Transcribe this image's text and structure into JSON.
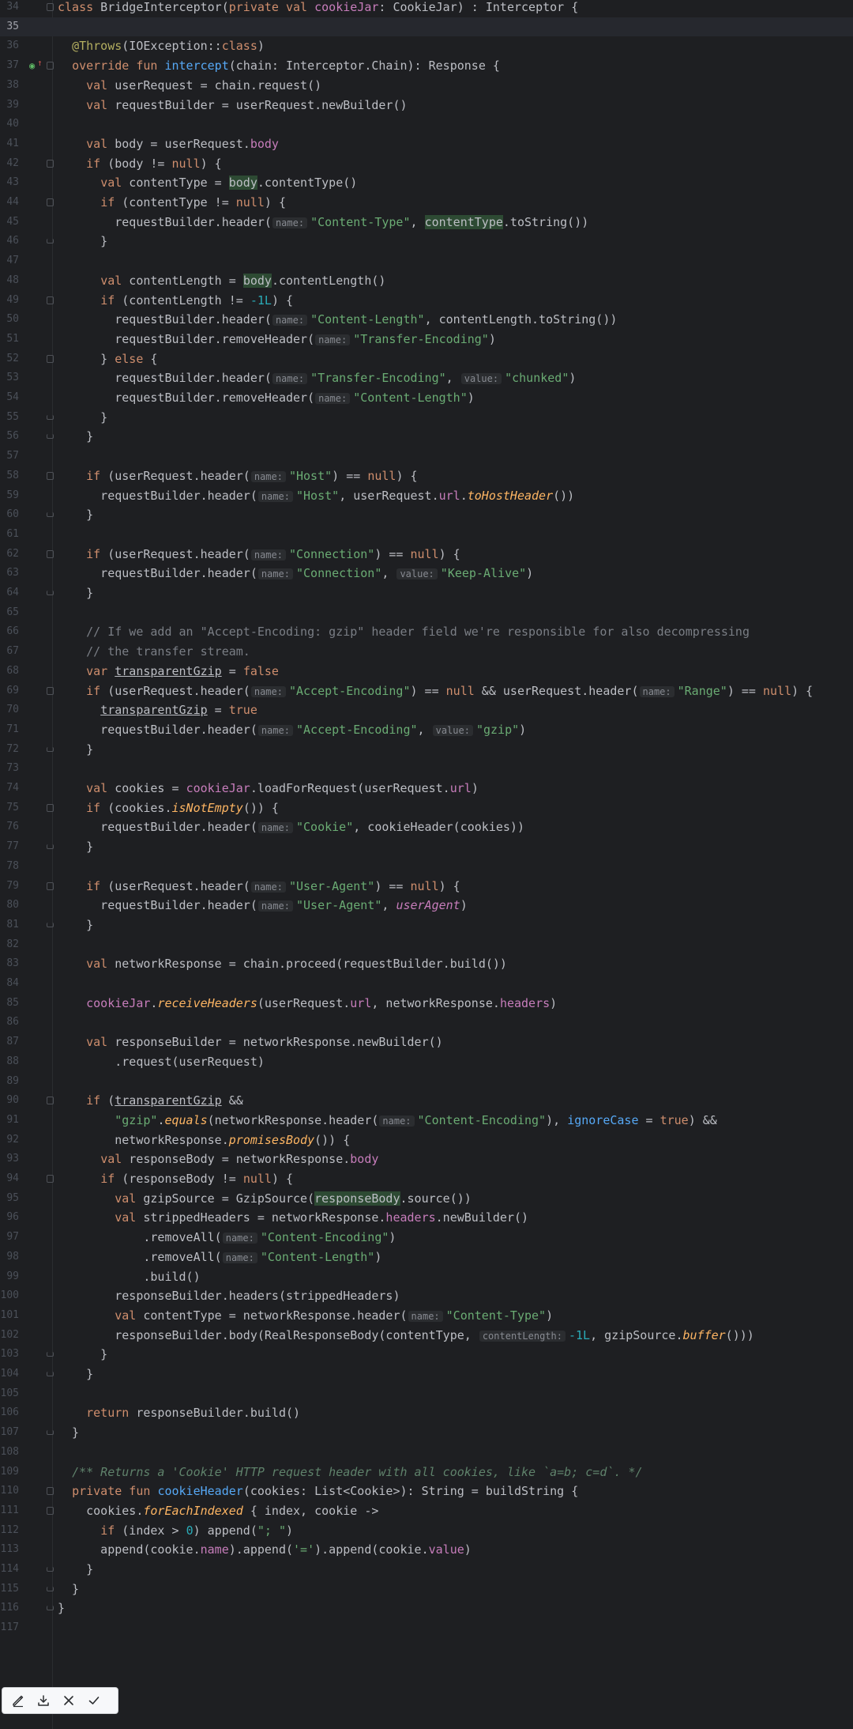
{
  "editor": {
    "language": "Kotlin",
    "current_line": 35,
    "lines": [
      {
        "n": "34",
        "fold": "start",
        "html": "<span class=\"kw\">class</span> BridgeInterceptor(<span class=\"kw\">private val</span> <span class=\"prop\">cookieJar</span>: CookieJar) : Interceptor {"
      },
      {
        "n": "35",
        "html": ""
      },
      {
        "n": "36",
        "html": "  <span class=\"ann\">@Throws</span>(IOException::<span class=\"kw\">class</span>)"
      },
      {
        "n": "37",
        "fold": "start",
        "marker": true,
        "html": "  <span class=\"kw\">override fun</span> <span class=\"fn\">intercept</span>(chain: Interceptor.Chain): Response {"
      },
      {
        "n": "38",
        "html": "    <span class=\"kw\">val</span> userRequest = chain.request()"
      },
      {
        "n": "39",
        "html": "    <span class=\"kw\">val</span> requestBuilder = userRequest.newBuilder()"
      },
      {
        "n": "40",
        "html": ""
      },
      {
        "n": "41",
        "html": "    <span class=\"kw\">val</span> body = userRequest.<span class=\"prop\">body</span>"
      },
      {
        "n": "42",
        "fold": "start",
        "html": "    <span class=\"kw\">if</span> (body != <span class=\"kw\">null</span>) {"
      },
      {
        "n": "43",
        "html": "      <span class=\"kw\">val</span> contentType = <span class=\"hl\">body</span>.contentType()"
      },
      {
        "n": "44",
        "fold": "start",
        "html": "      <span class=\"kw\">if</span> (contentType != <span class=\"kw\">null</span>) {"
      },
      {
        "n": "45",
        "html": "        requestBuilder.header(<span class=\"hint\">name:</span><span class=\"str\">\"Content-Type\"</span>, <span class=\"hl\">contentType</span>.toString())"
      },
      {
        "n": "46",
        "fold": "end",
        "html": "      }"
      },
      {
        "n": "47",
        "html": ""
      },
      {
        "n": "48",
        "html": "      <span class=\"kw\">val</span> contentLength = <span class=\"hl\">body</span>.contentLength()"
      },
      {
        "n": "49",
        "fold": "start",
        "html": "      <span class=\"kw\">if</span> (contentLength != <span class=\"num\">-1L</span>) {"
      },
      {
        "n": "50",
        "html": "        requestBuilder.header(<span class=\"hint\">name:</span><span class=\"str\">\"Content-Length\"</span>, contentLength.toString())"
      },
      {
        "n": "51",
        "html": "        requestBuilder.removeHeader(<span class=\"hint\">name:</span><span class=\"str\">\"Transfer-Encoding\"</span>)"
      },
      {
        "n": "52",
        "fold": "start",
        "html": "      } <span class=\"kw\">else</span> {"
      },
      {
        "n": "53",
        "html": "        requestBuilder.header(<span class=\"hint\">name:</span><span class=\"str\">\"Transfer-Encoding\"</span>, <span class=\"hint\">value:</span><span class=\"str\">\"chunked\"</span>)"
      },
      {
        "n": "54",
        "html": "        requestBuilder.removeHeader(<span class=\"hint\">name:</span><span class=\"str\">\"Content-Length\"</span>)"
      },
      {
        "n": "55",
        "fold": "end",
        "html": "      }"
      },
      {
        "n": "56",
        "fold": "end",
        "html": "    }"
      },
      {
        "n": "57",
        "html": ""
      },
      {
        "n": "58",
        "fold": "start",
        "html": "    <span class=\"kw\">if</span> (userRequest.header(<span class=\"hint\">name:</span><span class=\"str\">\"Host\"</span>) == <span class=\"kw\">null</span>) {"
      },
      {
        "n": "59",
        "html": "      requestBuilder.header(<span class=\"hint\">name:</span><span class=\"str\">\"Host\"</span>, userRequest.<span class=\"prop\">url</span>.<span class=\"ext\">toHostHeader</span>())"
      },
      {
        "n": "60",
        "fold": "end",
        "html": "    }"
      },
      {
        "n": "61",
        "html": ""
      },
      {
        "n": "62",
        "fold": "start",
        "html": "    <span class=\"kw\">if</span> (userRequest.header(<span class=\"hint\">name:</span><span class=\"str\">\"Connection\"</span>) == <span class=\"kw\">null</span>) {"
      },
      {
        "n": "63",
        "html": "      requestBuilder.header(<span class=\"hint\">name:</span><span class=\"str\">\"Connection\"</span>, <span class=\"hint\">value:</span><span class=\"str\">\"Keep-Alive\"</span>)"
      },
      {
        "n": "64",
        "fold": "end",
        "html": "    }"
      },
      {
        "n": "65",
        "html": ""
      },
      {
        "n": "66",
        "html": "    <span class=\"cmt\">// If we add an \"Accept-Encoding: gzip\" header field we're responsible for also decompressing</span>"
      },
      {
        "n": "67",
        "html": "    <span class=\"cmt\">// the transfer stream.</span>"
      },
      {
        "n": "68",
        "html": "    <span class=\"kw\">var</span> <span class=\"ul\">transparentGzip</span> = <span class=\"kw\">false</span>"
      },
      {
        "n": "69",
        "fold": "start",
        "html": "    <span class=\"kw\">if</span> (userRequest.header(<span class=\"hint\">name:</span><span class=\"str\">\"Accept-Encoding\"</span>) == <span class=\"kw\">null</span> &amp;&amp; userRequest.header(<span class=\"hint\">name:</span><span class=\"str\">\"Range\"</span>) == <span class=\"kw\">null</span>) {"
      },
      {
        "n": "70",
        "html": "      <span class=\"ul\">transparentGzip</span> = <span class=\"kw\">true</span>"
      },
      {
        "n": "71",
        "html": "      requestBuilder.header(<span class=\"hint\">name:</span><span class=\"str\">\"Accept-Encoding\"</span>, <span class=\"hint\">value:</span><span class=\"str\">\"gzip\"</span>)"
      },
      {
        "n": "72",
        "fold": "end",
        "html": "    }"
      },
      {
        "n": "73",
        "html": ""
      },
      {
        "n": "74",
        "html": "    <span class=\"kw\">val</span> cookies = <span class=\"prop\">cookieJar</span>.loadForRequest(userRequest.<span class=\"prop\">url</span>)"
      },
      {
        "n": "75",
        "fold": "start",
        "html": "    <span class=\"kw\">if</span> (cookies.<span class=\"ext\">isNotEmpty</span>()) {"
      },
      {
        "n": "76",
        "html": "      requestBuilder.header(<span class=\"hint\">name:</span><span class=\"str\">\"Cookie\"</span>, cookieHeader(cookies))"
      },
      {
        "n": "77",
        "fold": "end",
        "html": "    }"
      },
      {
        "n": "78",
        "html": ""
      },
      {
        "n": "79",
        "fold": "start",
        "html": "    <span class=\"kw\">if</span> (userRequest.header(<span class=\"hint\">name:</span><span class=\"str\">\"User-Agent\"</span>) == <span class=\"kw\">null</span>) {"
      },
      {
        "n": "80",
        "html": "      requestBuilder.header(<span class=\"hint\">name:</span><span class=\"str\">\"User-Agent\"</span>, <span class=\"prop it\">userAgent</span>)"
      },
      {
        "n": "81",
        "fold": "end",
        "html": "    }"
      },
      {
        "n": "82",
        "html": ""
      },
      {
        "n": "83",
        "html": "    <span class=\"kw\">val</span> networkResponse = chain.proceed(requestBuilder.build())"
      },
      {
        "n": "84",
        "html": ""
      },
      {
        "n": "85",
        "html": "    <span class=\"prop\">cookieJar</span>.<span class=\"ext\">receiveHeaders</span>(userRequest.<span class=\"prop\">url</span>, networkResponse.<span class=\"prop\">headers</span>)"
      },
      {
        "n": "86",
        "html": ""
      },
      {
        "n": "87",
        "html": "    <span class=\"kw\">val</span> responseBuilder = networkResponse.newBuilder()"
      },
      {
        "n": "88",
        "html": "        .request(userRequest)"
      },
      {
        "n": "89",
        "html": ""
      },
      {
        "n": "90",
        "fold": "start",
        "html": "    <span class=\"kw\">if</span> (<span class=\"ul\">transparentGzip</span> &amp;&amp;"
      },
      {
        "n": "91",
        "html": "        <span class=\"str\">\"gzip\"</span>.<span class=\"ext\">equals</span>(networkResponse.header(<span class=\"hint\">name:</span><span class=\"str\">\"Content-Encoding\"</span>), <span class=\"arg\">ignoreCase</span> = <span class=\"kw\">true</span>) &amp;&amp;"
      },
      {
        "n": "92",
        "html": "        networkResponse.<span class=\"ext\">promisesBody</span>()) {"
      },
      {
        "n": "93",
        "html": "      <span class=\"kw\">val</span> responseBody = networkResponse.<span class=\"prop\">body</span>"
      },
      {
        "n": "94",
        "fold": "start",
        "html": "      <span class=\"kw\">if</span> (responseBody != <span class=\"kw\">null</span>) {"
      },
      {
        "n": "95",
        "html": "        <span class=\"kw\">val</span> gzipSource = GzipSource(<span class=\"hl\">responseBody</span>.source())"
      },
      {
        "n": "96",
        "html": "        <span class=\"kw\">val</span> strippedHeaders = networkResponse.<span class=\"prop\">headers</span>.newBuilder()"
      },
      {
        "n": "97",
        "html": "            .removeAll(<span class=\"hint\">name:</span><span class=\"str\">\"Content-Encoding\"</span>)"
      },
      {
        "n": "98",
        "html": "            .removeAll(<span class=\"hint\">name:</span><span class=\"str\">\"Content-Length\"</span>)"
      },
      {
        "n": "99",
        "html": "            .build()"
      },
      {
        "n": "100",
        "html": "        responseBuilder.headers(strippedHeaders)"
      },
      {
        "n": "101",
        "html": "        <span class=\"kw\">val</span> contentType = networkResponse.header(<span class=\"hint\">name:</span><span class=\"str\">\"Content-Type\"</span>)"
      },
      {
        "n": "102",
        "html": "        responseBuilder.body(RealResponseBody(contentType, <span class=\"hint\">contentLength:</span><span class=\"num\">-1L</span>, gzipSource.<span class=\"ext\">buffer</span>()))"
      },
      {
        "n": "103",
        "fold": "end",
        "html": "      }"
      },
      {
        "n": "104",
        "fold": "end",
        "html": "    }"
      },
      {
        "n": "105",
        "html": ""
      },
      {
        "n": "106",
        "html": "    <span class=\"kw\">return</span> responseBuilder.build()"
      },
      {
        "n": "107",
        "fold": "end",
        "html": "  }"
      },
      {
        "n": "108",
        "html": ""
      },
      {
        "n": "109",
        "html": "  <span class=\"doc\">/** Returns a 'Cookie' HTTP request header with all cookies, like `a=b; c=d`. */</span>"
      },
      {
        "n": "110",
        "fold": "start",
        "html": "  <span class=\"kw\">private fun</span> <span class=\"fn\">cookieHeader</span>(cookies: List&lt;Cookie&gt;): String = buildString {"
      },
      {
        "n": "111",
        "fold": "start",
        "html": "    cookies.<span class=\"ext\">forEachIndexed</span> { index, cookie -&gt;"
      },
      {
        "n": "112",
        "html": "      <span class=\"kw\">if</span> (index &gt; <span class=\"num\">0</span>) append(<span class=\"str\">\"; \"</span>)"
      },
      {
        "n": "113",
        "html": "      append(cookie.<span class=\"prop\">name</span>).append(<span class=\"str\">'='</span>).append(cookie.<span class=\"prop\">value</span>)"
      },
      {
        "n": "114",
        "fold": "end",
        "html": "    }"
      },
      {
        "n": "115",
        "fold": "end",
        "html": "  }"
      },
      {
        "n": "116",
        "fold": "end",
        "html": "}"
      },
      {
        "n": "117",
        "html": ""
      }
    ]
  },
  "toolbar": {
    "buttons": [
      {
        "name": "edit-button",
        "icon": "pencil-icon"
      },
      {
        "name": "download-button",
        "icon": "download-icon"
      },
      {
        "name": "close-button",
        "icon": "close-icon"
      },
      {
        "name": "confirm-button",
        "icon": "check-icon"
      }
    ]
  }
}
